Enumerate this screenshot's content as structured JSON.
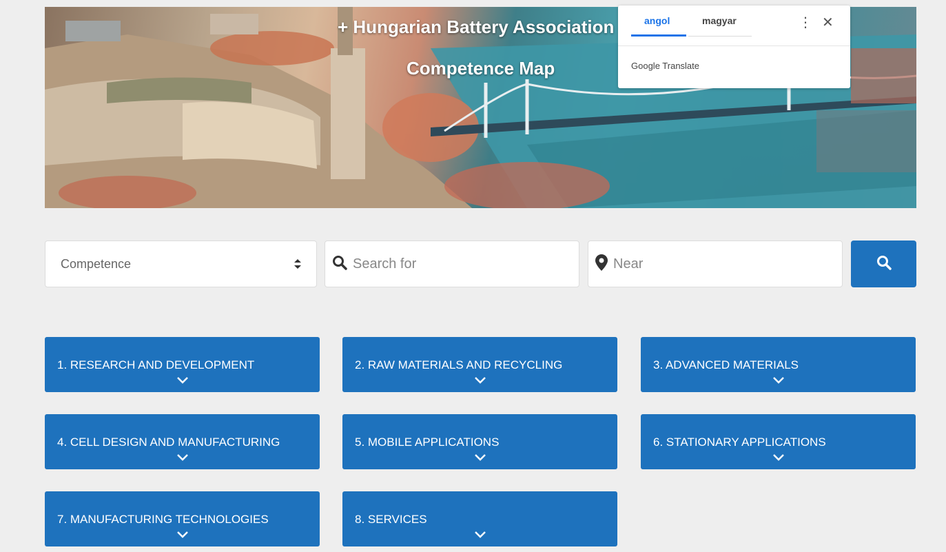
{
  "hero": {
    "title_line1": "+ Hungarian Battery Association -",
    "title_line2": "Competence Map"
  },
  "translate_popup": {
    "tab_source": "angol",
    "tab_target": "magyar",
    "brand": "Google Translate",
    "more_icon": "more-vert-icon",
    "close_icon": "close-icon"
  },
  "search": {
    "competence_label": "Competence",
    "search_placeholder": "Search for",
    "near_placeholder": "Near",
    "search_button_icon": "search-icon"
  },
  "categories": [
    {
      "label": "1. RESEARCH AND DEVELOPMENT"
    },
    {
      "label": "2. RAW MATERIALS AND RECYCLING"
    },
    {
      "label": "3. ADVANCED MATERIALS"
    },
    {
      "label": "4. CELL DESIGN AND MANUFACTURING"
    },
    {
      "label": "5. MOBILE APPLICATIONS"
    },
    {
      "label": "6. STATIONARY APPLICATIONS"
    },
    {
      "label": "7. MANUFACTURING TECHNOLOGIES"
    },
    {
      "label": "8. SERVICES"
    }
  ],
  "colors": {
    "accent": "#1e72bd",
    "background": "#eeeeee",
    "translate_active": "#1a73e8"
  }
}
